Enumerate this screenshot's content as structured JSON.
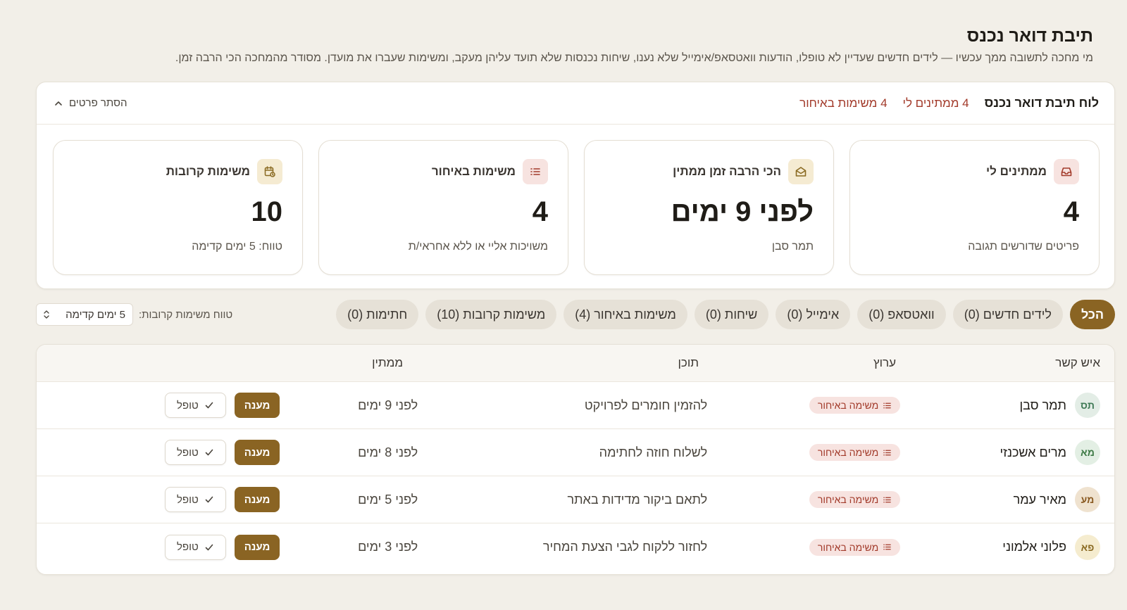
{
  "page": {
    "title": "תיבת דואר נכנס",
    "description": "מי מחכה לתשובה ממך עכשיו — לידים חדשים שעדיין לא טופלו, הודעות וואטסאפ/אימייל שלא נענו, שיחות נכנסות שלא תועד עליהן מעקב, ומשימות שעברו את מועדן. מסודר מהמחכה הכי הרבה זמן."
  },
  "summary": {
    "title": "לוח תיבת דואר נכנס",
    "stat_waiting": "4 ממתינים לי",
    "stat_overdue": "4 משימות באיחור",
    "toggle_label": "הסתר פרטים",
    "cards": [
      {
        "label": "ממתינים לי",
        "value": "4",
        "sub": "פריטים שדורשים תגובה",
        "icon": "inbox-icon",
        "tone": "red"
      },
      {
        "label": "הכי הרבה זמן ממתין",
        "value": "לפני 9 ימים",
        "sub": "תמר סבן",
        "icon": "envelope-open-icon",
        "tone": "gold"
      },
      {
        "label": "משימות באיחור",
        "value": "4",
        "sub": "משויכות אליי או ללא אחראי/ת",
        "icon": "list-icon",
        "tone": "red"
      },
      {
        "label": "משימות קרובות",
        "value": "10",
        "sub": "טווח: 5 ימים קדימה",
        "icon": "calendar-clock-icon",
        "tone": "gold"
      }
    ]
  },
  "filters": {
    "chips": [
      {
        "label": "הכל",
        "active": true
      },
      {
        "label": "לידים חדשים (0)",
        "active": false
      },
      {
        "label": "וואטסאפ (0)",
        "active": false
      },
      {
        "label": "אימייל (0)",
        "active": false
      },
      {
        "label": "שיחות (0)",
        "active": false
      },
      {
        "label": "משימות באיחור (4)",
        "active": false
      },
      {
        "label": "משימות קרובות (10)",
        "active": false
      },
      {
        "label": "חתימות (0)",
        "active": false
      }
    ],
    "range_label": "טווח משימות קרובות:",
    "range_value": "5 ימים קדימה"
  },
  "table": {
    "headers": {
      "contact": "איש קשר",
      "channel": "ערוץ",
      "content": "תוכן",
      "waiting": "ממתין"
    },
    "reply_label": "מענה",
    "done_label": "טופל",
    "rows": [
      {
        "initials": "תס",
        "name": "תמר סבן",
        "channel": "משימה באיחור",
        "content": "להזמין חומרים לפרויקט",
        "waiting": "לפני 9 ימים",
        "avatar_bg": "#e3ede6",
        "avatar_fg": "#3f7a56"
      },
      {
        "initials": "מא",
        "name": "מרים אשכנזי",
        "channel": "משימה באיחור",
        "content": "לשלוח חוזה לחתימה",
        "waiting": "לפני 8 ימים",
        "avatar_bg": "#e3efe4",
        "avatar_fg": "#3d7a45"
      },
      {
        "initials": "מע",
        "name": "מאיר עמר",
        "channel": "משימה באיחור",
        "content": "לתאם ביקור מדידות באתר",
        "waiting": "לפני 5 ימים",
        "avatar_bg": "#efe2cf",
        "avatar_fg": "#8a5a22"
      },
      {
        "initials": "פא",
        "name": "פלוני אלמוני",
        "channel": "משימה באיחור",
        "content": "לחזור ללקוח לגבי הצעת המחיר",
        "waiting": "לפני 3 ימים",
        "avatar_bg": "#f5eccf",
        "avatar_fg": "#8a6a22"
      }
    ]
  }
}
